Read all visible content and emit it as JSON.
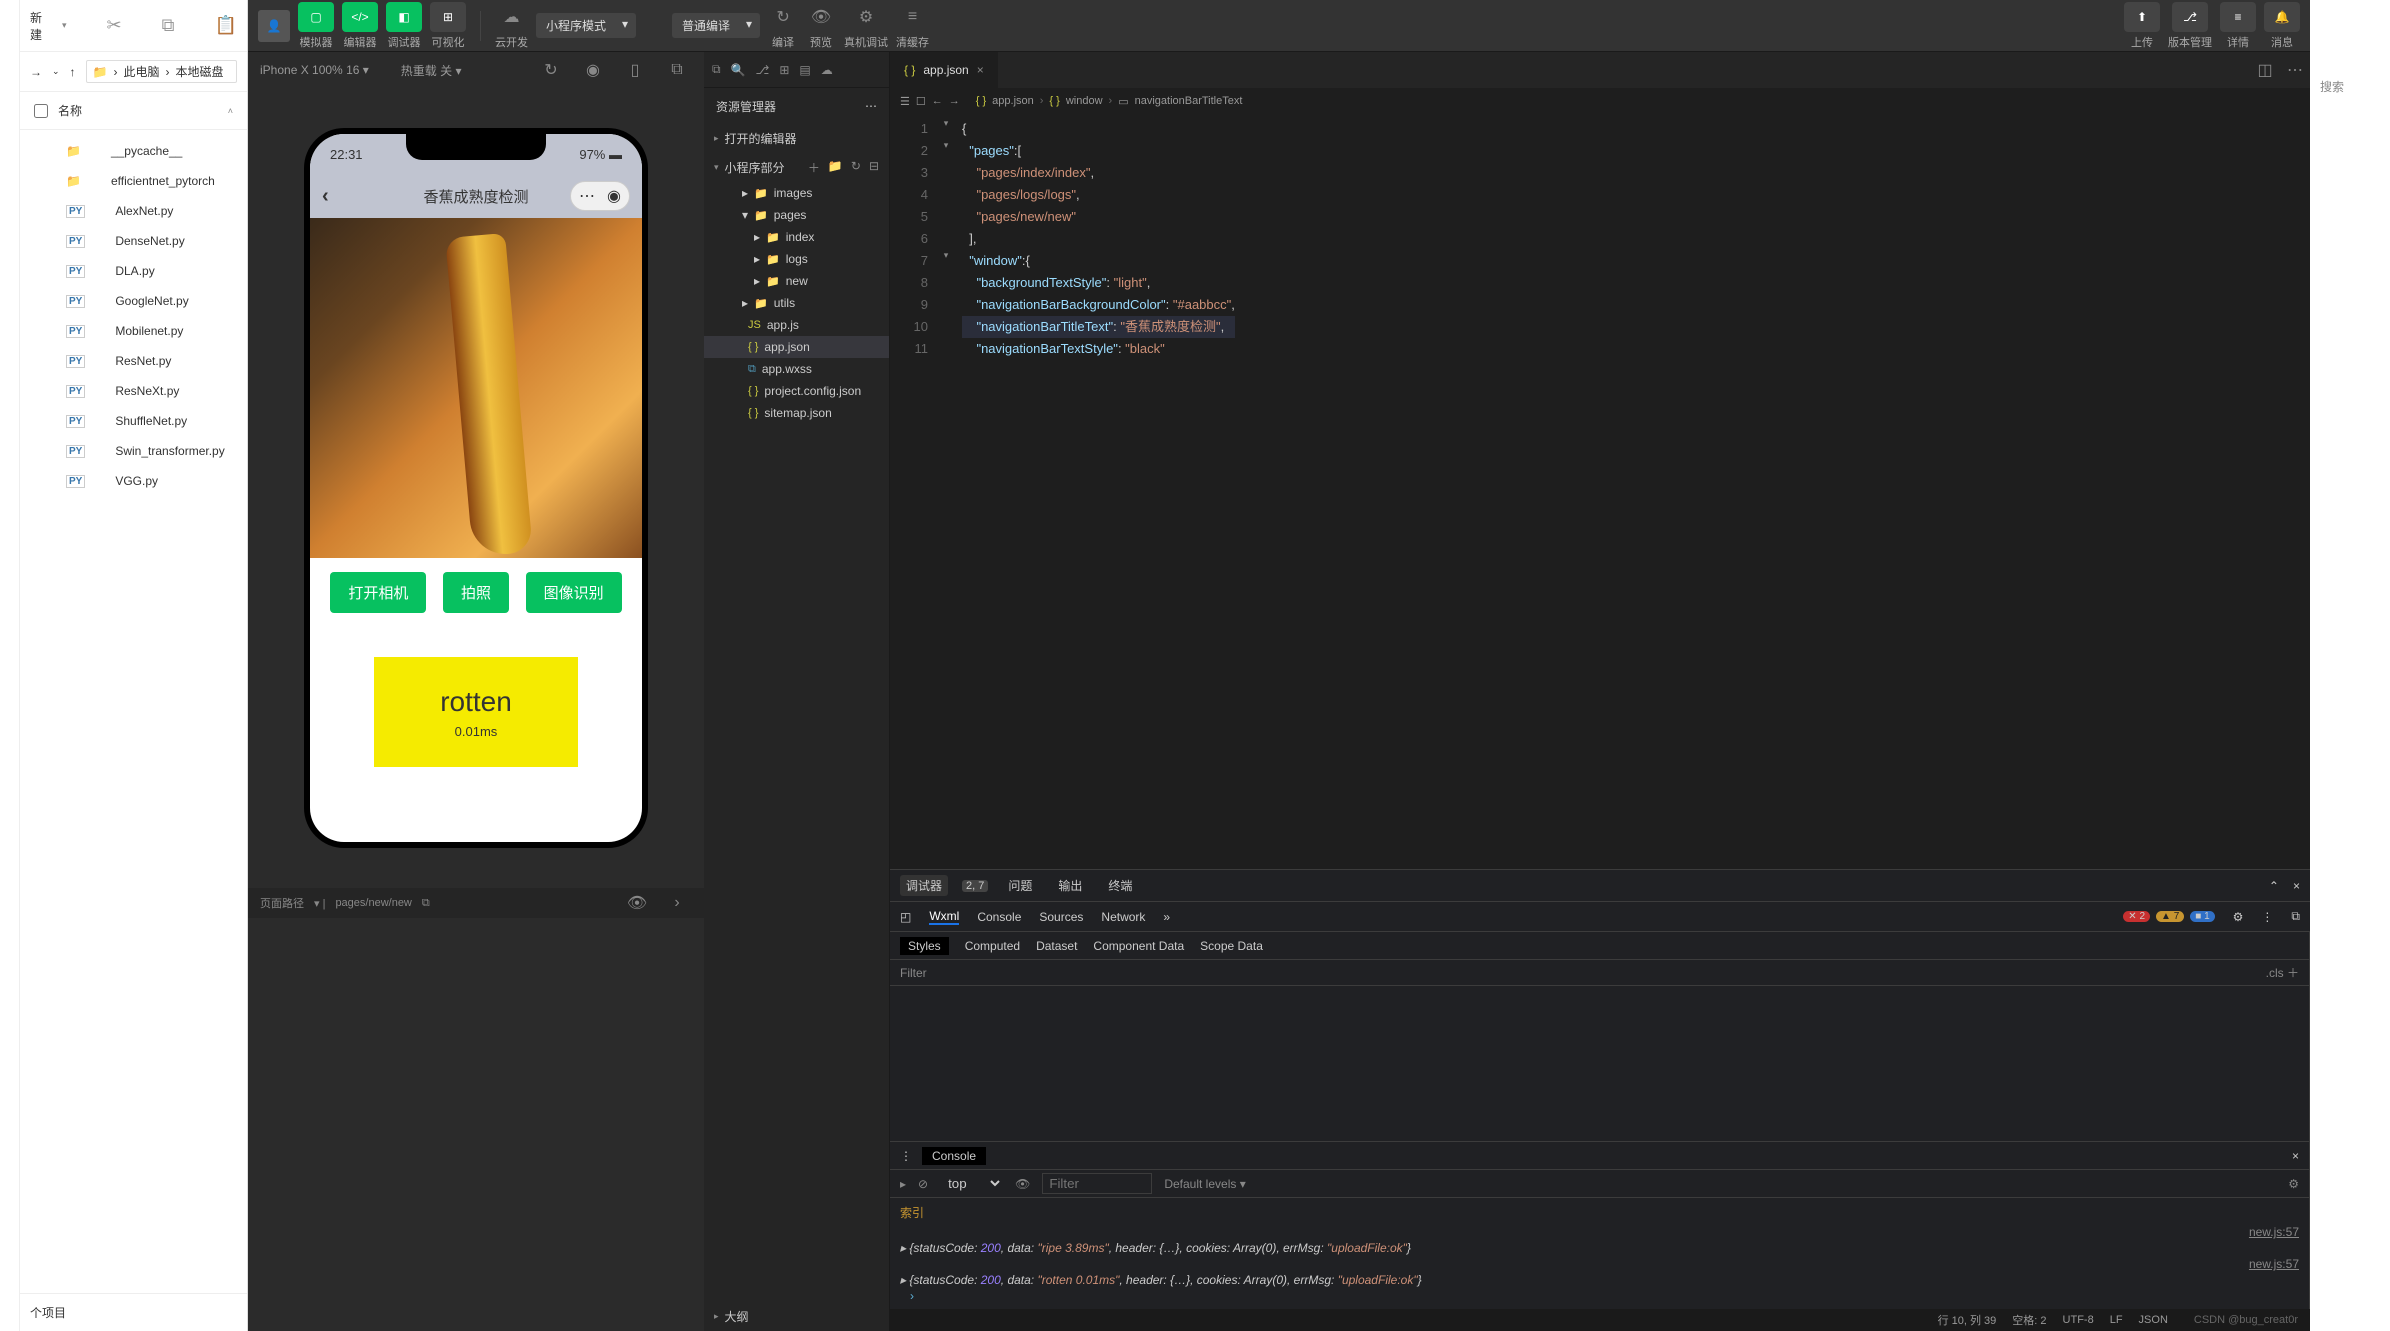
{
  "fe": {
    "new": "新建",
    "crumb1": "此电脑",
    "crumb2": "本地磁盘",
    "nameCol": "名称",
    "files": [
      {
        "icon": "folder",
        "name": "__pycache__"
      },
      {
        "icon": "folder",
        "name": "efficientnet_pytorch"
      },
      {
        "icon": "py",
        "name": "AlexNet.py"
      },
      {
        "icon": "py",
        "name": "DenseNet.py"
      },
      {
        "icon": "py",
        "name": "DLA.py"
      },
      {
        "icon": "py",
        "name": "GoogleNet.py"
      },
      {
        "icon": "py",
        "name": "Mobilenet.py"
      },
      {
        "icon": "py",
        "name": "ResNet.py"
      },
      {
        "icon": "py",
        "name": "ResNeXt.py"
      },
      {
        "icon": "py",
        "name": "ShuffleNet.py"
      },
      {
        "icon": "py",
        "name": "Swin_transformer.py"
      },
      {
        "icon": "py",
        "name": "VGG.py"
      }
    ],
    "bottom": "个项目"
  },
  "toolbar": {
    "simulator": "模拟器",
    "editor": "编辑器",
    "debugger": "调试器",
    "visualize": "可视化",
    "cloud": "云开发",
    "mode": "小程序模式",
    "compile": "普通编译",
    "compileBtn": "编译",
    "preview": "预览",
    "realDebug": "真机调试",
    "clearCache": "清缓存",
    "upload": "上传",
    "version": "版本管理",
    "details": "详情",
    "message": "消息"
  },
  "sim": {
    "device": "iPhone X 100% 16",
    "reload": "热重载 关",
    "time": "22:31",
    "battery": "97%",
    "title": "香蕉成熟度检测",
    "btn1": "打开相机",
    "btn2": "拍照",
    "btn3": "图像识别",
    "result": "rotten",
    "resultTime": "0.01ms",
    "pathLabel": "页面路径",
    "path": "pages/new/new"
  },
  "exp": {
    "title": "资源管理器",
    "open": "打开的编辑器",
    "proj": "小程序部分",
    "tree": [
      {
        "l": 2,
        "arr": "▸",
        "icon": "folder2",
        "name": "images"
      },
      {
        "l": 2,
        "arr": "▾",
        "icon": "folder2",
        "name": "pages"
      },
      {
        "l": 3,
        "arr": "▸",
        "icon": "folder",
        "name": "index"
      },
      {
        "l": 3,
        "arr": "▸",
        "icon": "folder",
        "name": "logs"
      },
      {
        "l": 3,
        "arr": "▸",
        "icon": "folder",
        "name": "new"
      },
      {
        "l": 2,
        "arr": "▸",
        "icon": "folder2",
        "name": "utils"
      },
      {
        "l": 2,
        "arr": "",
        "icon": "js",
        "name": "app.js"
      },
      {
        "l": 2,
        "arr": "",
        "icon": "json",
        "name": "app.json",
        "sel": true
      },
      {
        "l": 2,
        "arr": "",
        "icon": "wxss",
        "name": "app.wxss"
      },
      {
        "l": 2,
        "arr": "",
        "icon": "json",
        "name": "project.config.json"
      },
      {
        "l": 2,
        "arr": "",
        "icon": "json",
        "name": "sitemap.json"
      }
    ],
    "outline": "大纲"
  },
  "editor": {
    "tab": "app.json",
    "crumb": [
      "app.json",
      "window",
      "navigationBarTitleText"
    ],
    "lines": [
      {
        "n": 1,
        "f": "▾",
        "t": "{"
      },
      {
        "n": 2,
        "f": "▾",
        "t": "  \"pages\":["
      },
      {
        "n": 3,
        "f": "",
        "t": "    \"pages/index/index\","
      },
      {
        "n": 4,
        "f": "",
        "t": "    \"pages/logs/logs\","
      },
      {
        "n": 5,
        "f": "",
        "t": "    \"pages/new/new\""
      },
      {
        "n": 6,
        "f": "",
        "t": "  ],"
      },
      {
        "n": 7,
        "f": "▾",
        "t": "  \"window\":{"
      },
      {
        "n": 8,
        "f": "",
        "t": "    \"backgroundTextStyle\":\"light\","
      },
      {
        "n": 9,
        "f": "",
        "t": "    \"navigationBarBackgroundColor\": \"#aabbcc\","
      },
      {
        "n": 10,
        "f": "",
        "t": "    \"navigationBarTitleText\": \"香蕉成熟度检测\",",
        "hl": true
      },
      {
        "n": 11,
        "f": "",
        "t": "    \"navigationBarTextStyle\":\"black\""
      }
    ]
  },
  "dev": {
    "tabs1": {
      "debugger": "调试器",
      "count": "2, 7",
      "problems": "问题",
      "output": "输出",
      "terminal": "终端"
    },
    "tabs2": [
      "Wxml",
      "Console",
      "Sources",
      "Network"
    ],
    "errors": "2",
    "warnings": "7",
    "info": "1",
    "styleTabs": [
      "Styles",
      "Computed",
      "Dataset",
      "Component Data",
      "Scope Data"
    ],
    "filter": "Filter",
    "cls": ".cls",
    "console": "Console",
    "top": "top",
    "defaultLevels": "Default levels",
    "idx": "索引",
    "log1_src": "new.js:57",
    "log1": "{statusCode: 200, data: \"ripe 3.89ms\", header: {…}, cookies: Array(0), errMsg: \"uploadFile:ok\"}",
    "log2_src": "new.js:57",
    "log2": "{statusCode: 200, data: \"rotten 0.01ms\", header: {…}, cookies: Array(0), errMsg: \"uploadFile:ok\"}"
  },
  "status": {
    "line": "行 10, 列 39",
    "spaces": "空格: 2",
    "enc": "UTF-8",
    "eol": "LF",
    "lang": "JSON",
    "watermark": "CSDN @bug_creat0r"
  },
  "search": "搜索"
}
